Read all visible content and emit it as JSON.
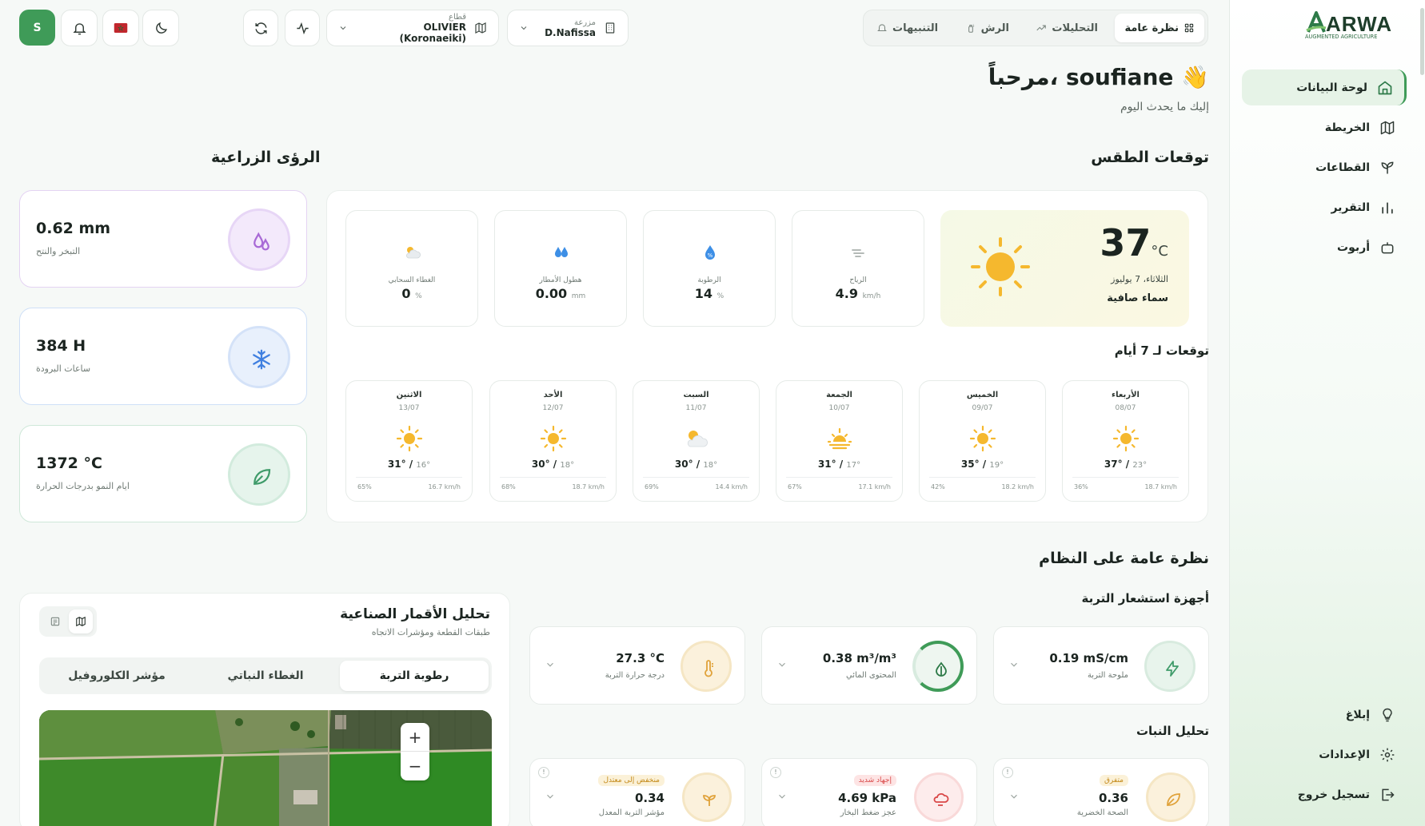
{
  "sidebar": {
    "logo_text": "ARWA",
    "logo_tagline": "AUGMENTED AGRICULTURE",
    "items": [
      {
        "label": "لوحة البيانات",
        "icon": "home-icon"
      },
      {
        "label": "الخريطة",
        "icon": "map-icon"
      },
      {
        "label": "القطاعات",
        "icon": "sprout-icon"
      },
      {
        "label": "التقرير",
        "icon": "bar-chart-icon"
      },
      {
        "label": "أربوت",
        "icon": "bot-icon"
      }
    ],
    "bottom_items": [
      {
        "label": "إبلاغ",
        "icon": "lightbulb-icon"
      },
      {
        "label": "الإعدادات",
        "icon": "gear-icon"
      },
      {
        "label": "تسجيل خروج",
        "icon": "logout-icon"
      }
    ]
  },
  "topbar": {
    "tabs": [
      {
        "label": "نظرة عامة",
        "icon": "grid-icon"
      },
      {
        "label": "التحليلات",
        "icon": "trend-icon"
      },
      {
        "label": "الرش",
        "icon": "spray-icon"
      },
      {
        "label": "التنبيهات",
        "icon": "bell-icon"
      }
    ],
    "farm_caption": "مزرعة",
    "farm_value": "D.Nafissa",
    "sector_caption": "قطاع",
    "sector_value": "OLIVIER (Koronaeiki)",
    "avatar_letter": "S"
  },
  "greeting": {
    "title": "مرحباً، soufiane 👋",
    "subtitle": "إليك ما يحدث اليوم"
  },
  "weather": {
    "section_title": "توقعات الطقس",
    "current_temp": "37",
    "temp_unit": "°C",
    "date": "الثلاثاء، 7 يوليوز",
    "condition": "سماء صافية",
    "metrics": [
      {
        "label": "الرياح",
        "value": "4.9",
        "unit": "km/h",
        "icon": "wind-icon"
      },
      {
        "label": "الرطوبة",
        "value": "14",
        "unit": "%",
        "icon": "humidity-icon"
      },
      {
        "label": "هطول الأمطار",
        "value": "0.00",
        "unit": "mm",
        "icon": "rain-drops-icon"
      },
      {
        "label": "الغطاء السحابي",
        "value": "0",
        "unit": "%",
        "icon": "cloud-sun-icon"
      }
    ],
    "forecast_title": "توقعات لـ 7 أيام",
    "forecast": [
      {
        "day": "الأربعاء",
        "date": "08/07",
        "icon": "sun-icon",
        "high": "37°",
        "low": "23°",
        "humidity": "36%",
        "wind": "18.7 km/h"
      },
      {
        "day": "الخميس",
        "date": "09/07",
        "icon": "sun-icon",
        "high": "35°",
        "low": "19°",
        "humidity": "42%",
        "wind": "18.2 km/h"
      },
      {
        "day": "الجمعة",
        "date": "10/07",
        "icon": "sunset-icon",
        "high": "31°",
        "low": "17°",
        "humidity": "67%",
        "wind": "17.1 km/h"
      },
      {
        "day": "السبت",
        "date": "11/07",
        "icon": "cloud-sun-icon",
        "high": "30°",
        "low": "18°",
        "humidity": "69%",
        "wind": "14.4 km/h"
      },
      {
        "day": "الأحد",
        "date": "12/07",
        "icon": "sun-icon",
        "high": "30°",
        "low": "18°",
        "humidity": "68%",
        "wind": "18.7 km/h"
      },
      {
        "day": "الاثنين",
        "date": "13/07",
        "icon": "sun-icon",
        "high": "31°",
        "low": "16°",
        "humidity": "65%",
        "wind": "16.7 km/h"
      }
    ]
  },
  "insights": {
    "section_title": "الرؤى الزراعية",
    "cards": [
      {
        "value": "0.62 mm",
        "label": "التبخر والنتح",
        "icon": "drops-icon",
        "color": "#a86ad6"
      },
      {
        "value": "384 H",
        "label": "ساعات البرودة",
        "icon": "snowflake-icon",
        "color": "#3f7fe0"
      },
      {
        "value": "1372 °C",
        "label": "ايام النمو بدرجات الحرارة",
        "icon": "leaf-icon",
        "color": "#3f9b6a"
      }
    ]
  },
  "system": {
    "section_title": "نظرة عامة على النظام",
    "soil_title": "أجهزة استشعار التربة",
    "soil": [
      {
        "value": "0.19 mS/cm",
        "label": "ملوحة التربة",
        "icon": "bolt-icon"
      },
      {
        "value": "0.38 m³/m³",
        "label": "المحتوى المائي",
        "icon": "water-gauge-icon"
      },
      {
        "value": "27.3 °C",
        "label": "درجة حرارة التربة",
        "icon": "thermometer-icon"
      }
    ],
    "plant_title": "تحليل النبات",
    "plant": [
      {
        "badge": "متفرق",
        "value": "0.36",
        "label": "الصحة الخضرية",
        "icon": "leaf-icon"
      },
      {
        "badge": "إجهاد شديد",
        "value": "4.69 kPa",
        "label": "عجز ضغط البخار",
        "icon": "wind-cloud-icon"
      },
      {
        "badge": "منخفض إلى معتدل",
        "value": "0.34",
        "label": "مؤشر التربة المعدل",
        "icon": "seedling-icon"
      }
    ]
  },
  "satellite": {
    "title": "تحليل الأقمار الصناعية",
    "subtitle": "طبقات القطعة ومؤشرات الاتجاه",
    "segments": [
      "رطوبة التربة",
      "الغطاء النباتي",
      "مؤشر الكلوروفيل"
    ]
  },
  "colors": {
    "accent": "#3f9b58",
    "sun": "#f5b82e"
  }
}
